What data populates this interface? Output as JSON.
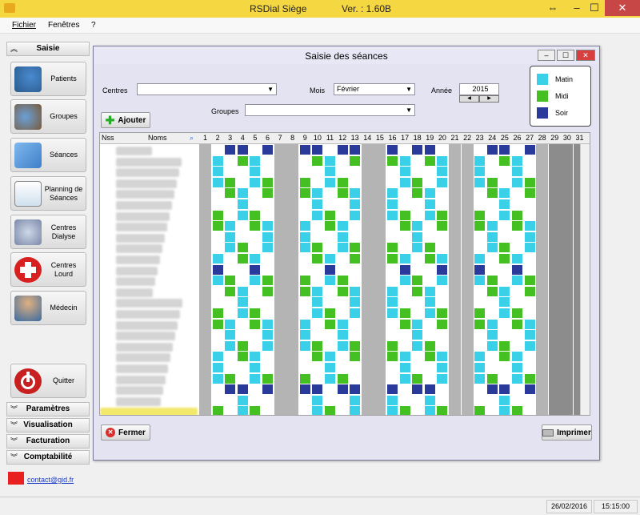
{
  "window": {
    "title": "RSDial  Siège",
    "version": "Ver. : 1.60B"
  },
  "menu": [
    "Fichier",
    "Fenêtres",
    "?"
  ],
  "sidebar": {
    "section": "Saisie",
    "buttons": [
      {
        "label": "Patients",
        "icon": "patients-icon"
      },
      {
        "label": "Groupes",
        "icon": "groups-icon"
      },
      {
        "label": "Séances",
        "icon": "calendar-icon"
      },
      {
        "label": "Planning de Séances",
        "icon": "planning-icon"
      },
      {
        "label": "Centres Dialyse",
        "icon": "stethoscope-icon"
      },
      {
        "label": "Centres Lourd",
        "icon": "red-cross-icon"
      },
      {
        "label": "Médecin",
        "icon": "doctor-icon"
      }
    ],
    "quit": "Quitter",
    "panels": [
      "Paramètres",
      "Visualisation",
      "Facturation",
      "Comptabilité"
    ],
    "contact": "contact@gid.fr"
  },
  "dialog": {
    "title": "Saisie des séances",
    "labels": {
      "centres": "Centres",
      "mois": "Mois",
      "annee": "Année",
      "groupes": "Groupes"
    },
    "mois_value": "Février",
    "annee_value": "2015",
    "add_button": "Ajouter",
    "close_button": "Fermer",
    "print_button": "Imprimer",
    "legend": [
      {
        "label": "Matin",
        "color": "#3ad0e8"
      },
      {
        "label": "Midi",
        "color": "#44c022"
      },
      {
        "label": "Soir",
        "color": "#2a3a9a"
      }
    ],
    "columns": {
      "nss": "Nss",
      "noms": "Noms",
      "days": [
        1,
        2,
        3,
        4,
        5,
        6,
        7,
        8,
        9,
        10,
        11,
        12,
        13,
        14,
        15,
        16,
        17,
        18,
        19,
        20,
        21,
        22,
        23,
        24,
        25,
        26,
        27,
        28,
        29,
        30,
        31
      ]
    },
    "rows": 25
  },
  "status": {
    "date": "26/02/2016",
    "time": "15:15:00"
  }
}
